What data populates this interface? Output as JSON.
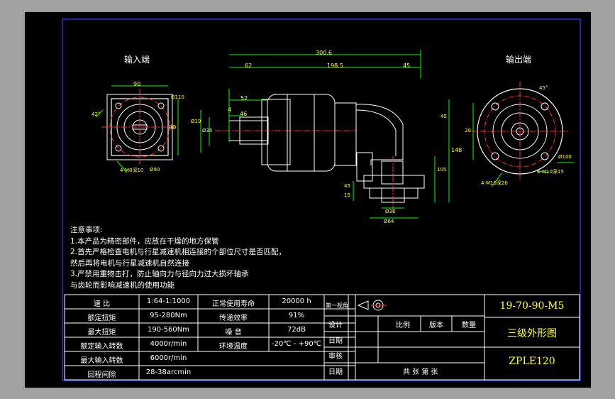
{
  "views": {
    "input_title": "输入端",
    "output_title": "输出端"
  },
  "dimensions": {
    "total_length": "300.6",
    "d62": "62",
    "d198": "198.5",
    "d45": "45",
    "d52": "52",
    "d4": "4",
    "d46": "46",
    "shaft_dia": "Ø19",
    "spigot_dia": "Ø35",
    "d90_top": "90",
    "d90_right": "90",
    "d110": "Ø110",
    "d42": "42°",
    "screw_in": "4-M8深10",
    "d90_bot": "Ø90",
    "h45": "45",
    "h148": "148",
    "h105": "105",
    "h45b": "45",
    "h15": "15",
    "w_out1": "Ø36",
    "w_out2": "Ø64",
    "r45": "45°",
    "d20": "20",
    "d100": "Ø100",
    "screw_out1": "4-M10深15",
    "screw_out2": "4-M10深20"
  },
  "notes": {
    "title": "注意事项:",
    "lines": [
      "1.本产品为精密部件，应放在干燥的地方保管",
      "2.首先严格检查电机与行星减速机相连接的个部位尺寸是否匹配，",
      "然后再将电机与行星减速机自然连接",
      "3.严禁用重物击打，防止轴向力与径向力过大损坏轴承",
      "与齿轮而影响减速机的使用功能"
    ]
  },
  "spec_table": [
    {
      "label": "速    比",
      "value": "1:64-1:1000",
      "label2": "正常使用寿命",
      "value2": "20000 h"
    },
    {
      "label": "额定扭矩",
      "value": "95-280Nm",
      "label2": "传递效率",
      "value2": "91%"
    },
    {
      "label": "最大扭矩",
      "value": "190-560Nm",
      "label2": "噪    音",
      "value2": "72dB"
    },
    {
      "label": "额定输入转数",
      "value": "4000r/min",
      "label2": "环境温度",
      "value2": "-20℃ - +90℃"
    },
    {
      "label": "最大输入转数",
      "value": "6000r/min",
      "label2": "",
      "value2": ""
    },
    {
      "label": "回程间隙",
      "value": "28-38arcmin",
      "label2": "",
      "value2": ""
    }
  ],
  "title_block": {
    "projection": "第一视角",
    "design": "设计",
    "date1": "日期",
    "review": "审核",
    "date2": "日期",
    "scale": "比例",
    "version": "版本",
    "quantity": "数量",
    "sheets": "共    张    第    张",
    "code": "19-70-90-M5",
    "name": "三级外形图",
    "model": "ZPLE120"
  },
  "colors": {
    "line_white": "#ffffff",
    "line_green": "#00ff00",
    "line_yellow": "#ffff33",
    "line_red": "#ff3333",
    "line_cyan": "#00ffff",
    "line_blue": "#3344ff",
    "background": "#000000"
  }
}
